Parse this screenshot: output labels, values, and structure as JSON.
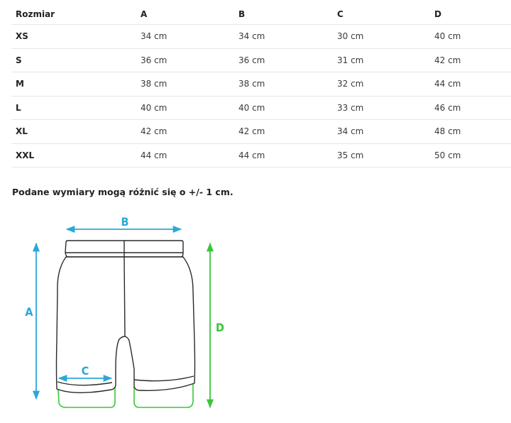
{
  "table": {
    "headers": [
      "Rozmiar",
      "A",
      "B",
      "C",
      "D"
    ],
    "rows": [
      [
        "XS",
        "34 cm",
        "34 cm",
        "30 cm",
        "40 cm"
      ],
      [
        "S",
        "36 cm",
        "36 cm",
        "31 cm",
        "42 cm"
      ],
      [
        "M",
        "38 cm",
        "38 cm",
        "32 cm",
        "44 cm"
      ],
      [
        "L",
        "40 cm",
        "40 cm",
        "33 cm",
        "46 cm"
      ],
      [
        "XL",
        "42 cm",
        "42 cm",
        "34 cm",
        "48 cm"
      ],
      [
        "XXL",
        "44 cm",
        "44 cm",
        "35 cm",
        "50 cm"
      ]
    ]
  },
  "note": "Podane wymiary mogą różnić się o +/- 1 cm.",
  "diagram": {
    "labels": {
      "a": "A",
      "b": "B",
      "c": "C",
      "d": "D"
    },
    "colors": {
      "measure_blue": "#29a8d6",
      "measure_green": "#3cc43c",
      "outline": "#2a2a2a",
      "lining_green": "#39c639"
    },
    "icons": [
      "shorts-outline-icon",
      "double-arrow-icon"
    ]
  }
}
